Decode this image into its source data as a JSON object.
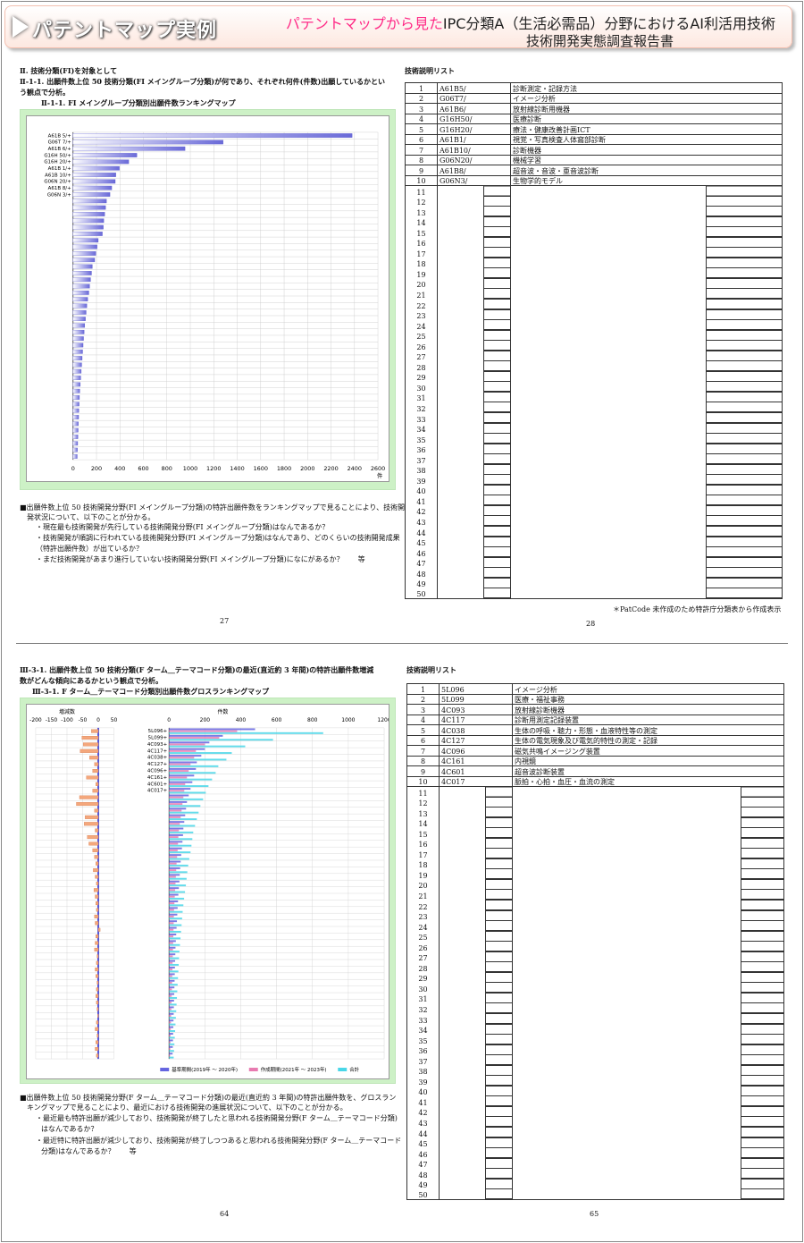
{
  "header": {
    "title": "パテントマップ実例",
    "subtitle_pink": "パテントマップから見た",
    "subtitle_black": "IPC分類A（生活必需品）分野におけるAI利活用技術",
    "subtitle2": "技術開発実態調査報告書"
  },
  "p27": {
    "sec": "Ⅱ. 技術分類(FI)を対象として",
    "h1": "Ⅱ-1-1. 出願件数上位 50 技術分類(FI メイングループ分類)が何であり、それぞれ何件(件数)出願しているかとい",
    "h1b": "う観点で分析。",
    "cap": "Ⅱ-1-1. FI メイングループ分類別出願件数ランキングマップ",
    "n1": "■出願件数上位 50 技術開発分野(FI メイングループ分類)の特許出願件数をランキングマップで見ることにより、技術開",
    "n2": "発状況について、以下のことが分かる。",
    "n3": "・現在最も技術開発が先行している技術開発分野(FI メイングループ分類)はなんであるか？",
    "n4": "・技術開発が順調に行われている技術開発分野(FI メイングループ分類)はなんであり、どのくらいの技術開発成果",
    "n5": "（特許出願件数）が出ているか？",
    "n6": "・まだ技術開発があまり進行していない技術開発分野(FI メイングループ分類)になにがあるか？　　等",
    "page": "27"
  },
  "p28": {
    "title": "技術説明リスト",
    "note": "＊PatCode 未作成のため特許庁分類表から作成表示",
    "page": "28",
    "rows": [
      {
        "no": "1",
        "code": "A61B5/",
        "desc": "診断測定・記録方法"
      },
      {
        "no": "2",
        "code": "G06T7/",
        "desc": "イメージ分析"
      },
      {
        "no": "3",
        "code": "A61B6/",
        "desc": "放射線診断用機器"
      },
      {
        "no": "4",
        "code": "G16H50/",
        "desc": "医療診断"
      },
      {
        "no": "5",
        "code": "G16H20/",
        "desc": "療法・健康改善計画ICT"
      },
      {
        "no": "6",
        "code": "A61B1/",
        "desc": "視覚・写真検査人体窩部診断"
      },
      {
        "no": "7",
        "code": "A61B10/",
        "desc": "診断機器"
      },
      {
        "no": "8",
        "code": "G06N20/",
        "desc": "機械学習"
      },
      {
        "no": "9",
        "code": "A61B8/",
        "desc": "超音波・音波・亜音波診断"
      },
      {
        "no": "10",
        "code": "G06N3/",
        "desc": "生物学的モデル"
      }
    ]
  },
  "p64": {
    "h1": "Ⅲ-3-1. 出願件数上位 50 技術分類(F ターム＿テーマコード分類)の最近(直近約 3 年間)の特許出願件数増減",
    "h1b": "数がどんな傾向にあるかという観点で分析。",
    "cap": "Ⅲ-3-1. F ターム＿テーマコード分類別出願件数グロスランキングマップ",
    "n1": "■出願件数上位 50 技術開発分野(F ターム＿テーマコード分類)の最近(直近約 3 年間)の特許出願件数を、グロスラン",
    "n2": "キングマップで見ることにより、最近における技術開発の進展状況について、以下のことが分かる。",
    "n3": "・最近最も特許出願が減少しており、技術開発が終了したと思われる技術開発分野(F ターム＿テーマコード分類)",
    "n4": "はなんであるか？",
    "n5": "・最近特に特許出願が減少しており、技術開発が終了しつつあると思われる技術開発分野(F ターム＿テーマコード",
    "n6": "分類)はなんであるか？　　等",
    "page": "64"
  },
  "p65": {
    "title": "技術説明リスト",
    "page": "65",
    "rows": [
      {
        "no": "1",
        "code": "5L096",
        "desc": "イメージ分析"
      },
      {
        "no": "2",
        "code": "5L099",
        "desc": "医療・福祉事務"
      },
      {
        "no": "3",
        "code": "4C093",
        "desc": "放射線診断機器"
      },
      {
        "no": "4",
        "code": "4C117",
        "desc": "診断用測定記録装置"
      },
      {
        "no": "5",
        "code": "4C038",
        "desc": "生体の呼吸・聴力・形態・血液特性等の測定"
      },
      {
        "no": "6",
        "code": "4C127",
        "desc": "生体の電気現象及び電気的特性の測定・記録"
      },
      {
        "no": "7",
        "code": "4C096",
        "desc": "磁気共鳴イメージング装置"
      },
      {
        "no": "8",
        "code": "4C161",
        "desc": "内視鏡"
      },
      {
        "no": "9",
        "code": "4C601",
        "desc": "超音波診断装置"
      },
      {
        "no": "10",
        "code": "4C017",
        "desc": "脈拍・心拍・血圧・血流の測定"
      }
    ]
  },
  "chart_data": [
    {
      "type": "bar",
      "orientation": "horizontal",
      "xlim": [
        0,
        2600
      ],
      "xticks": [
        0,
        200,
        400,
        600,
        800,
        1000,
        1200,
        1400,
        1600,
        1800,
        2000,
        2200,
        2400,
        2600
      ],
      "xunit": "件",
      "grid": true,
      "categories": [
        "A61B 5/+",
        "G06T 7/+",
        "A61B 6/+",
        "G16H 50/+",
        "G16H 20/+",
        "A61B 1/+",
        "A61B 10/+",
        "G06N 20/+",
        "A61B 8/+",
        "G06N 3/+"
      ],
      "values": [
        2380,
        1280,
        955,
        545,
        475,
        395,
        365,
        360,
        330,
        315,
        285,
        278,
        270,
        262,
        258,
        250,
        215,
        205,
        195,
        185,
        165,
        158,
        150,
        142,
        135,
        125,
        118,
        112,
        106,
        100,
        95,
        90,
        86,
        82,
        78,
        74,
        70,
        66,
        62,
        58,
        55,
        52,
        50,
        48,
        46,
        44,
        42,
        40,
        38,
        36
      ],
      "color": "#6a6ad8"
    },
    {
      "type": "bar",
      "orientation": "horizontal",
      "subtype": "gross",
      "grid": true,
      "left_panel": {
        "label": "増減数",
        "xlim": [
          -200,
          20
        ],
        "xticks": [
          -200,
          -150,
          -100,
          -50,
          0,
          50
        ],
        "values": [
          -22,
          -52,
          -48,
          -58,
          -28,
          -12,
          -18,
          -38,
          -8,
          -18,
          -60,
          -70,
          -12,
          -42,
          -45,
          -10,
          -35,
          -30,
          -18,
          -12,
          -8,
          -16,
          -10,
          -6,
          -14,
          -10,
          -8,
          -6,
          -12,
          -10,
          6,
          -8,
          -10,
          -12,
          -4,
          -6,
          -10,
          -8,
          -4,
          -6,
          -8,
          -6,
          -4,
          -2,
          -6,
          -10,
          -4,
          -8,
          -10,
          -6
        ]
      },
      "right_panel": {
        "label": "件数",
        "xlim": [
          0,
          1200
        ],
        "xticks": [
          0,
          200,
          400,
          600,
          800,
          1000,
          1200
        ]
      },
      "categories": [
        "5L096+",
        "5L099+",
        "4C093+",
        "4C117+",
        "4C038+",
        "4C127+",
        "4C096+",
        "4C161+",
        "4C601+",
        "4C017+"
      ],
      "series": [
        {
          "name": "基準期間(2019年 ～ 2020年)",
          "color": "#6464e0",
          "values": [
            480,
            300,
            225,
            200,
            180,
            155,
            150,
            140,
            130,
            120,
            110,
            100,
            95,
            90,
            85,
            80,
            78,
            75,
            72,
            68,
            65,
            62,
            60,
            58,
            55,
            52,
            50,
            48,
            46,
            44,
            42,
            40,
            38,
            36,
            35,
            34,
            33,
            32,
            31,
            30,
            29,
            28,
            27,
            26,
            25,
            24,
            23,
            22,
            21,
            20
          ]
        },
        {
          "name": "作成期間(2021年 ～ 2023年)",
          "color": "#e87ab0",
          "values": [
            380,
            280,
            200,
            150,
            140,
            120,
            110,
            100,
            90,
            85,
            80,
            75,
            70,
            65,
            60,
            55,
            52,
            50,
            48,
            45,
            42,
            40,
            38,
            36,
            34,
            32,
            30,
            28,
            27,
            26,
            25,
            24,
            23,
            22,
            21,
            20,
            19,
            18,
            17,
            16,
            15,
            14,
            13,
            12,
            11,
            10,
            9,
            8,
            7,
            6
          ]
        },
        {
          "name": "合計",
          "color": "#48d6e8",
          "values": [
            860,
            580,
            425,
            350,
            320,
            275,
            260,
            240,
            220,
            205,
            190,
            175,
            165,
            155,
            145,
            135,
            130,
            125,
            120,
            113,
            107,
            102,
            98,
            94,
            89,
            84,
            80,
            76,
            73,
            70,
            67,
            64,
            61,
            58,
            56,
            54,
            52,
            50,
            48,
            46,
            44,
            42,
            40,
            38,
            36,
            34,
            32,
            30,
            28,
            26
          ]
        }
      ]
    }
  ]
}
